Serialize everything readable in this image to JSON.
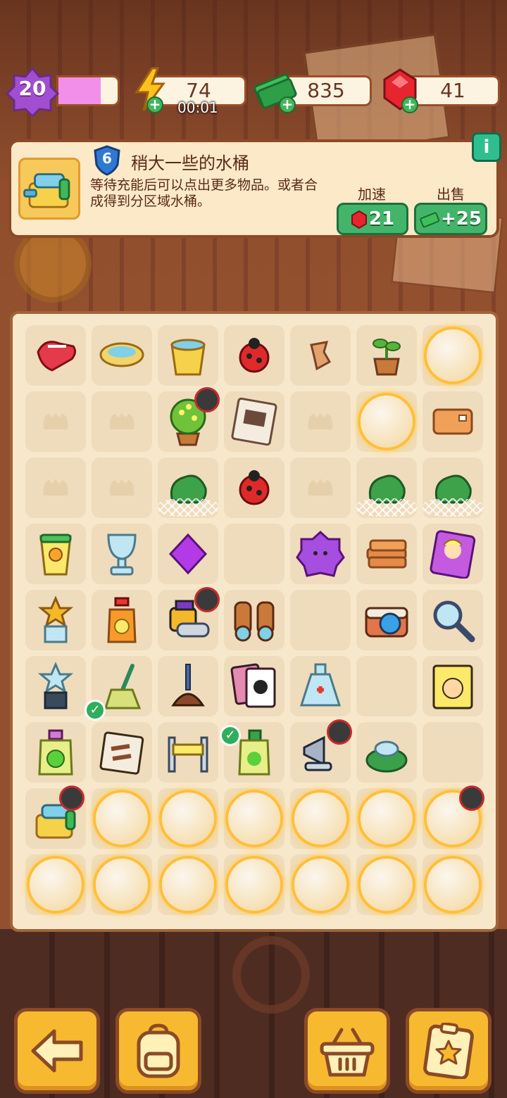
{
  "hud": {
    "level": "20",
    "xp_fraction": 0.72,
    "energy": "74",
    "energy_timer": "00:01",
    "cash": "835",
    "gems": "41",
    "plus": "+"
  },
  "info": {
    "item_level": "6",
    "title": "稍大一些的水桶",
    "description": "等待充能后可以点出更多物品。或者合成得到分区域水桶。",
    "speedup_label": "加速",
    "speedup_cost": "21",
    "sell_label": "出售",
    "sell_value": "+25",
    "info_icon": "i"
  },
  "colors": {
    "accent_green": "#43b56a",
    "board_bg": "#f7e8cc",
    "frame": "#8b4a26",
    "bubble_glow": "#ffbf3a"
  },
  "board": {
    "rows": [
      [
        "gloves-icon",
        "bowl-icon",
        "bucket-icon",
        "ladybug-icon",
        "wood-scrap-icon",
        "sprout-pot-icon",
        "bubble-item"
      ],
      [
        "empty-locked",
        "empty-locked",
        "flower-tree-icon",
        "wanted-poster-icon",
        "empty-locked",
        "bubble-item",
        "cloth-icon"
      ],
      [
        "empty-locked",
        "empty-locked",
        "bush-web",
        "ladybug-icon",
        "empty-locked",
        "bush-web",
        "bush-web"
      ],
      [
        "juice-cup-icon",
        "trophy-cup-icon",
        "purple-gem-icon",
        "empty",
        "purple-star-icon",
        "cloth-stack-icon",
        "portrait-icon"
      ],
      [
        "gold-trophy-icon",
        "juice-bottle-icon",
        "film-roll-icon",
        "binoculars-icon",
        "empty",
        "camera-icon",
        "magnifier-icon"
      ],
      [
        "star-trophy-icon",
        "broom-icon",
        "plunger-icon",
        "cards-icon",
        "potion-icon",
        "empty",
        "detective-card-icon"
      ],
      [
        "detergent-icon",
        "bag-icon",
        "barrier-icon",
        "cleaner-bottle-icon",
        "megaphone-icon",
        "dust-pile-icon",
        "empty"
      ],
      [
        "bucket-generator-icon",
        "bubble-item",
        "bubble-item",
        "bubble-item",
        "bubble-item",
        "bubble-item",
        "bubble-item"
      ],
      [
        "bubble-item",
        "bubble-item",
        "bubble-item",
        "bubble-item",
        "bubble-item",
        "bubble-item",
        "bubble-item"
      ]
    ]
  },
  "buttons": {
    "back": "back-arrow-icon",
    "backpack": "backpack-icon",
    "basket": "basket-icon",
    "tasks": "task-note-icon"
  }
}
